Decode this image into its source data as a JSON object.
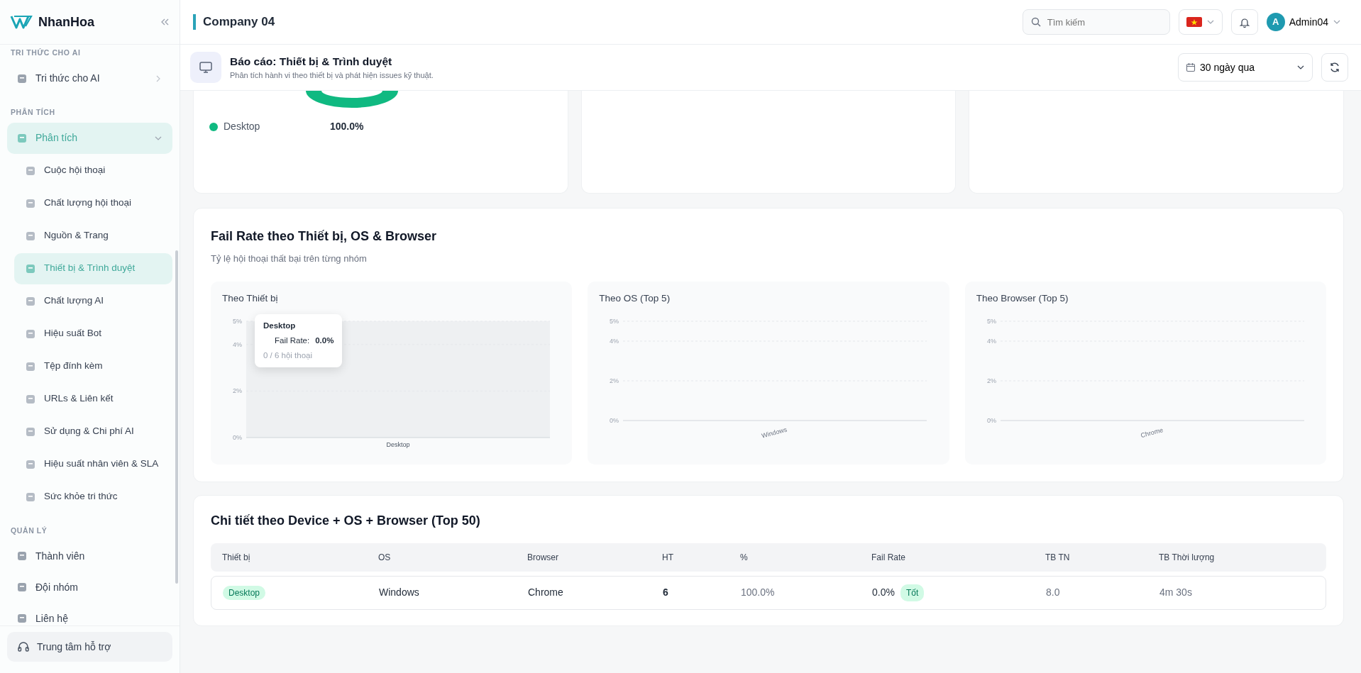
{
  "sidebar": {
    "brand": "NhanHoa",
    "sections": [
      {
        "title": "TRI THỨC CHO AI",
        "items": [
          {
            "label": "Tri thức cho AI",
            "selected": false,
            "kind": "submenu",
            "expanded": false
          }
        ]
      },
      {
        "title": "PHÂN TÍCH",
        "items": [
          {
            "label": "Phân tích",
            "selected": true,
            "kind": "submenu",
            "expanded": true,
            "children": [
              {
                "label": "Cuộc hội thoại",
                "selected": false
              },
              {
                "label": "Chất lượng hội thoại",
                "selected": false
              },
              {
                "label": "Nguồn & Trang",
                "selected": false
              },
              {
                "label": "Thiết bị & Trình duyệt",
                "selected": true
              },
              {
                "label": "Chất lượng AI",
                "selected": false
              },
              {
                "label": "Hiệu suất Bot",
                "selected": false
              },
              {
                "label": "Tệp đính kèm",
                "selected": false
              },
              {
                "label": "URLs & Liên kết",
                "selected": false
              },
              {
                "label": "Sử dụng & Chi phí AI",
                "selected": false
              },
              {
                "label": "Hiệu suất nhân viên & SLA",
                "selected": false
              },
              {
                "label": "Sức khỏe tri thức",
                "selected": false
              }
            ]
          }
        ]
      },
      {
        "title": "QUẢN LÝ",
        "items": [
          {
            "label": "Thành viên",
            "selected": false,
            "kind": "link"
          },
          {
            "label": "Đội nhóm",
            "selected": false,
            "kind": "link"
          },
          {
            "label": "Liên hệ",
            "selected": false,
            "kind": "link"
          }
        ]
      }
    ],
    "support_button": "Trung tâm hỗ trợ"
  },
  "topbar": {
    "title": "Company 04",
    "search": {
      "placeholder": "Tìm kiếm"
    },
    "user": {
      "initial": "A",
      "name": "Admin04"
    }
  },
  "report_header": {
    "title": "Báo cáo: Thiết bị & Trình duyệt",
    "subtitle": "Phân tích hành vi theo thiết bị và phát hiện issues kỹ thuật.",
    "range": "30 ngày qua"
  },
  "summary_legend": [
    {
      "label": "Desktop",
      "value": "100.0%",
      "color": "#10b981"
    }
  ],
  "fail_rate": {
    "title": "Fail Rate theo Thiết bị, OS & Browser",
    "subtitle": "Tỷ lệ hội thoại thất bại trên từng nhóm",
    "charts": [
      {
        "title": "Theo Thiết bị",
        "chart_data": {
          "type": "bar",
          "categories": [
            "Desktop"
          ],
          "values": [
            0
          ],
          "ylim": [
            0,
            5
          ],
          "yticks": [
            {
              "value": 0,
              "label": "0%"
            },
            {
              "value": 2,
              "label": "2%"
            },
            {
              "value": 4,
              "label": "4%"
            },
            {
              "value": 5,
              "label": "5%"
            }
          ]
        },
        "tooltip": {
          "title": "Desktop",
          "label": "Fail Rate:",
          "value": "0.0%",
          "note": "0 / 6 hội thoại"
        }
      },
      {
        "title": "Theo OS (Top 5)",
        "chart_data": {
          "type": "bar",
          "categories": [
            "Windows"
          ],
          "values": [
            0
          ],
          "ylim": [
            0,
            5
          ],
          "yticks": [
            {
              "value": 0,
              "label": "0%"
            },
            {
              "value": 2,
              "label": "2%"
            },
            {
              "value": 4,
              "label": "4%"
            },
            {
              "value": 5,
              "label": "5%"
            }
          ]
        }
      },
      {
        "title": "Theo Browser (Top 5)",
        "chart_data": {
          "type": "bar",
          "categories": [
            "Chrome"
          ],
          "values": [
            0
          ],
          "ylim": [
            0,
            5
          ],
          "yticks": [
            {
              "value": 0,
              "label": "0%"
            },
            {
              "value": 2,
              "label": "2%"
            },
            {
              "value": 4,
              "label": "4%"
            },
            {
              "value": 5,
              "label": "5%"
            }
          ]
        }
      }
    ]
  },
  "detail_table": {
    "title": "Chi tiết theo Device + OS + Browser (Top 50)",
    "columns": [
      "Thiết bị",
      "OS",
      "Browser",
      "HT",
      "%",
      "Fail Rate",
      "TB TN",
      "TB Thời lượng"
    ],
    "rows": [
      {
        "device": "Desktop",
        "os": "Windows",
        "browser": "Chrome",
        "ht": "6",
        "share": "100.0%",
        "fail_rate": "0.0%",
        "status": "Tốt",
        "avg_messages": "8.0",
        "avg_duration": "4m 30s"
      }
    ]
  }
}
